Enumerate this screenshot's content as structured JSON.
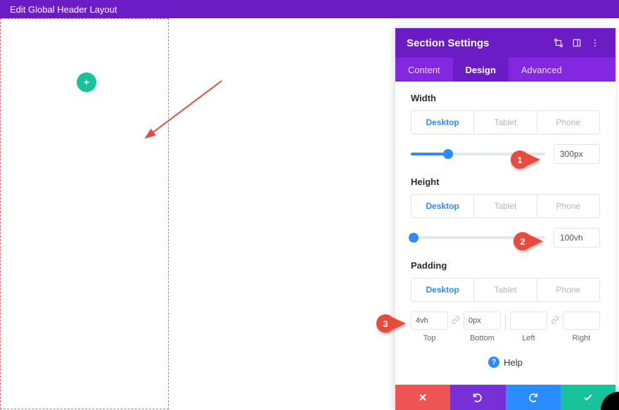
{
  "topbar": {
    "title": "Edit Global Header Layout"
  },
  "panel": {
    "title": "Section Settings",
    "tabs": {
      "content": "Content",
      "design": "Design",
      "advanced": "Advanced",
      "active": "design"
    },
    "width": {
      "label": "Width",
      "devices": {
        "desktop": "Desktop",
        "tablet": "Tablet",
        "phone": "Phone"
      },
      "value": "300px",
      "slider_pct": 28
    },
    "height": {
      "label": "Height",
      "devices": {
        "desktop": "Desktop",
        "tablet": "Tablet",
        "phone": "Phone"
      },
      "value": "100vh",
      "slider_pct": 2
    },
    "padding": {
      "label": "Padding",
      "devices": {
        "desktop": "Desktop",
        "tablet": "Tablet",
        "phone": "Phone"
      },
      "top": {
        "label": "Top",
        "value": "4vh"
      },
      "bottom": {
        "label": "Bottom",
        "value": "0px"
      },
      "left": {
        "label": "Left",
        "value": ""
      },
      "right": {
        "label": "Right",
        "value": ""
      }
    },
    "help": "Help"
  },
  "badges": {
    "one": "1",
    "two": "2",
    "three": "3"
  }
}
